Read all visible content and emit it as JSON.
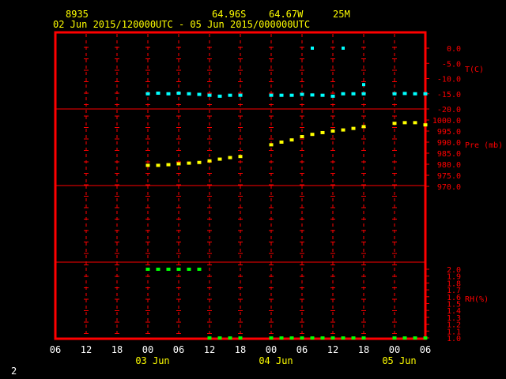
{
  "header": {
    "station": "8935",
    "lat": "64.96S",
    "lon": "64.67W",
    "elev": "25M",
    "period": "02 Jun 2015/120000UTC - 05 Jun 2015/000000UTC"
  },
  "footer": {
    "page": "2"
  },
  "chart_data": {
    "type": "scatter",
    "x_unit": "hours since 02 Jun 2015 06 UTC",
    "x_ticks": [
      "06",
      "12",
      "18",
      "00",
      "06",
      "12",
      "18",
      "00",
      "06",
      "12",
      "18",
      "00",
      "06"
    ],
    "x_dates": [
      "03 Jun",
      "04 Jun",
      "05 Jun"
    ],
    "panels": [
      {
        "name": "temperature",
        "label": "T(C)",
        "color": "#00ffff",
        "ticks": [
          "0.0",
          "-5.0",
          "-10.0",
          "-15.0",
          "-20.0"
        ],
        "ylim": [
          -20,
          0
        ],
        "x": [
          18,
          20,
          22,
          24,
          26,
          28,
          30,
          32,
          34,
          36,
          42,
          44,
          46,
          48,
          50,
          52,
          54,
          56,
          58,
          60,
          66,
          68,
          70,
          72
        ],
        "values": [
          -15,
          -14.8,
          -15,
          -14.8,
          -15,
          -15.2,
          -15.5,
          -15.8,
          -15.5,
          -15.5,
          -15.5,
          -15.5,
          -15.5,
          -15.2,
          -15.4,
          -15.5,
          -15.8,
          -15,
          -15,
          -15,
          -15,
          -14.9,
          -15,
          -15
        ]
      },
      {
        "name": "pressure",
        "label": "Pre (mb)",
        "color": "#ffff00",
        "ticks": [
          "1000.0",
          "995.0",
          "990.0",
          "985.0",
          "980.0",
          "975.0",
          "970.0"
        ],
        "ylim": [
          970,
          1000
        ],
        "x": [
          18,
          20,
          22,
          24,
          26,
          28,
          30,
          32,
          34,
          36,
          42,
          44,
          46,
          48,
          50,
          52,
          54,
          56,
          58,
          60,
          66,
          68,
          70,
          72
        ],
        "values": [
          979.5,
          979.5,
          979.8,
          980.2,
          980.5,
          980.8,
          981.5,
          982.3,
          983,
          983.5,
          988.8,
          990,
          991,
          992.5,
          993.5,
          994.3,
          995,
          995.5,
          996.2,
          997,
          998.5,
          998.8,
          998.8,
          997.8
        ]
      },
      {
        "name": "humidity",
        "label": "RH(%)",
        "color": "#00ff00",
        "ticks": [
          "2.0",
          "1.9",
          "1.8",
          "1.7",
          "1.6",
          "1.5",
          "1.4",
          "1.3",
          "1.2",
          "1.1",
          "1.0"
        ],
        "ylim": [
          1.0,
          2.0
        ],
        "x": [
          18,
          20,
          22,
          24,
          26,
          28,
          30,
          32,
          34,
          36,
          42,
          44,
          46,
          48,
          50,
          52,
          54,
          56,
          58,
          60,
          66,
          68,
          70,
          72
        ],
        "values": [
          2.0,
          2.0,
          2.0,
          2.0,
          2.0,
          2.0,
          1.0,
          1.0,
          1.0,
          1.0,
          1.0,
          1.0,
          1.0,
          1.0,
          1.0,
          1.0,
          1.0,
          1.0,
          1.0,
          1.0,
          1.0,
          1.0,
          1.0,
          1.0
        ]
      }
    ],
    "temperature_isolated": {
      "x": [
        50,
        56
      ],
      "values": [
        0,
        0
      ]
    },
    "temperature_outlier": {
      "x": [
        60
      ],
      "values": [
        -12
      ]
    },
    "grid": true
  }
}
